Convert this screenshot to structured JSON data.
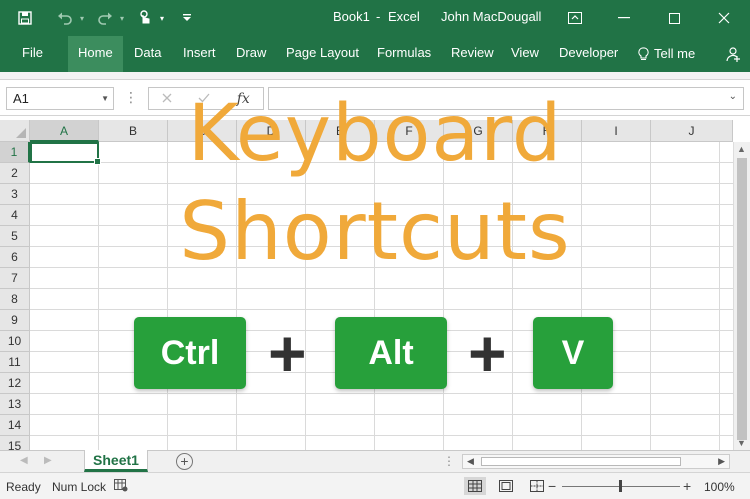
{
  "window": {
    "doc_title": "Book1",
    "separator": "-",
    "app_name": "Excel",
    "user": "John MacDougall"
  },
  "icons": {
    "save": "save-icon",
    "undo": "undo-icon",
    "redo": "redo-icon",
    "touch": "touch-mode-icon",
    "customize": "customize-qat-icon",
    "ribbon_display": "ribbon-display-options-icon",
    "minimize": "minimize-icon",
    "maximize": "maximize-icon",
    "close": "close-icon",
    "lightbulb": "lightbulb-icon",
    "share": "share-icon"
  },
  "ribbon": {
    "tabs": [
      "File",
      "Home",
      "Data",
      "Insert",
      "Draw",
      "Page Layout",
      "Formulas",
      "Review",
      "View",
      "Developer"
    ],
    "active_tab": "Home",
    "tell_me": "Tell me"
  },
  "formula_bar": {
    "name_box": "A1",
    "fx_label": "fx",
    "value": ""
  },
  "grid": {
    "columns": [
      "A",
      "B",
      "C",
      "D",
      "E",
      "F",
      "G",
      "H",
      "I",
      "J"
    ],
    "rows": [
      "1",
      "2",
      "3",
      "4",
      "5",
      "6",
      "7",
      "8",
      "9",
      "10",
      "11",
      "12",
      "13",
      "14",
      "15"
    ],
    "selected_cell": "A1"
  },
  "overlay": {
    "line1": "Keyboard",
    "line2": "Shortcuts",
    "keys": [
      "Ctrl",
      "Alt",
      "V"
    ],
    "plus": "+"
  },
  "sheets": {
    "tabs": [
      "Sheet1"
    ],
    "active": "Sheet1"
  },
  "status": {
    "ready": "Ready",
    "num_lock": "Num Lock",
    "zoom_minus": "−",
    "zoom_plus": "+",
    "zoom_level": "100%"
  },
  "colors": {
    "excel_green": "#217346",
    "overlay_orange": "#f0a93a",
    "key_green": "#27a03b"
  }
}
